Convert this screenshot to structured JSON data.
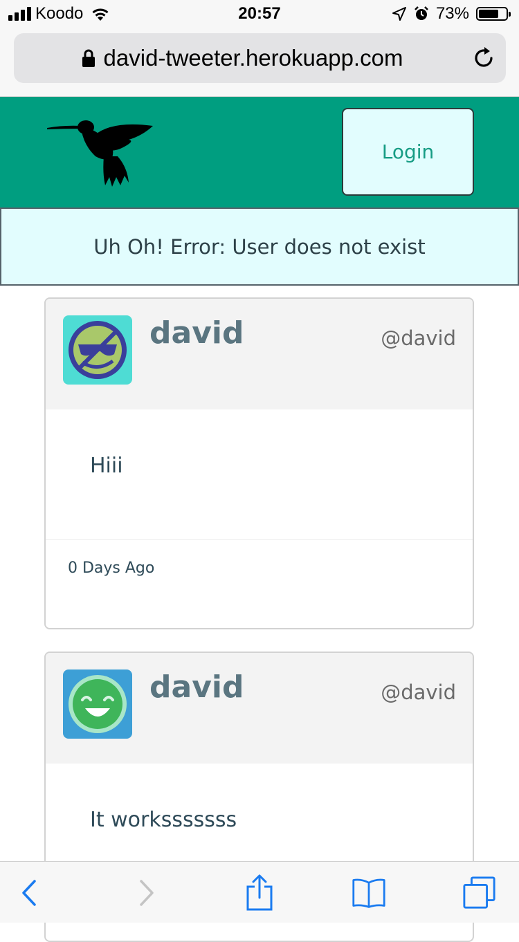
{
  "status_bar": {
    "carrier": "Koodo",
    "time": "20:57",
    "battery_percent": "73%",
    "battery_level": 0.73,
    "signal_bars": 4
  },
  "browser": {
    "url": "david-tweeter.herokuapp.com"
  },
  "header": {
    "logo_icon": "hummingbird-logo",
    "login_label": "Login"
  },
  "error": {
    "message": "Uh Oh! Error: User does not exist"
  },
  "tweets": [
    {
      "author": "david",
      "handle": "@david",
      "avatar_icon": "cool-face-avatar",
      "text": "Hiii",
      "time_ago": "0 Days Ago"
    },
    {
      "author": "david",
      "handle": "@david",
      "avatar_icon": "smiling-face-avatar",
      "text": "It worksssssss",
      "time_ago": ""
    }
  ],
  "toolbar": {
    "icons": [
      "back-icon",
      "forward-icon",
      "share-icon",
      "bookmarks-icon",
      "tabs-icon"
    ]
  },
  "colors": {
    "header_bg": "#009e80",
    "banner_bg": "#e2fdfe",
    "ios_blue": "#1a7bf0"
  }
}
